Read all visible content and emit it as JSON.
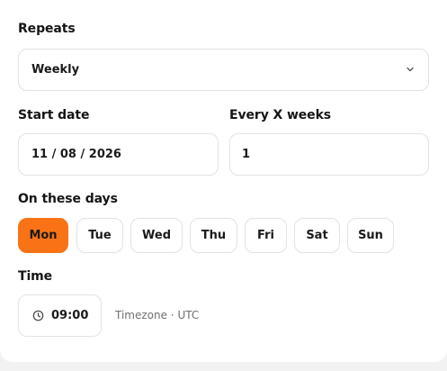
{
  "repeats": {
    "label": "Repeats",
    "value": "Weekly"
  },
  "start_date": {
    "label": "Start date",
    "value": "11 / 08 / 2026"
  },
  "every_weeks": {
    "label": "Every X weeks",
    "value": "1"
  },
  "days": {
    "label": "On these days",
    "items": [
      "Mon",
      "Tue",
      "Wed",
      "Thu",
      "Fri",
      "Sat",
      "Sun"
    ],
    "selected": "Mon"
  },
  "time": {
    "label": "Time",
    "value": "09:00",
    "timezone": "Timezone · UTC"
  },
  "colors": {
    "accent": "#f97316",
    "border": "#e2e2e2",
    "muted": "#707070"
  },
  "icons": {
    "select": "chevron-down-icon",
    "time": "clock-icon"
  }
}
